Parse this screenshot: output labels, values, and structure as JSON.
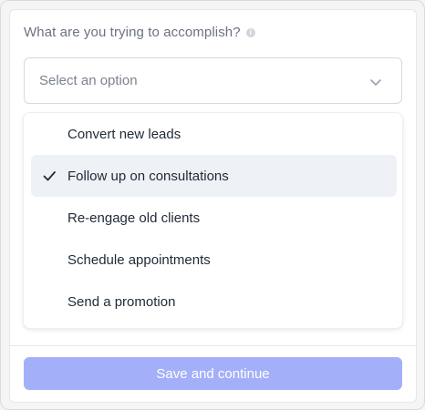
{
  "form": {
    "question": "What are you trying to accomplish?",
    "info_icon": "info-circle-icon",
    "select": {
      "placeholder": "Select an option",
      "icon": "chevron-down-icon"
    },
    "options": [
      {
        "label": "Convert new leads",
        "selected": false
      },
      {
        "label": "Follow up on consultations",
        "selected": true
      },
      {
        "label": "Re-engage old clients",
        "selected": false
      },
      {
        "label": "Schedule appointments",
        "selected": false
      },
      {
        "label": "Send a promotion",
        "selected": false
      }
    ],
    "submit_label": "Save and continue",
    "submit_disabled": true
  },
  "colors": {
    "accent_disabled": "#a3b0f9",
    "selected_option_bg": "#eef1f6",
    "text_primary": "#1f2937",
    "text_muted": "#6b7280"
  }
}
